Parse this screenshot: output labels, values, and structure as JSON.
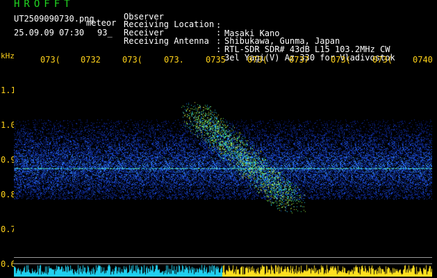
{
  "header": {
    "app": "HROFFT",
    "filename": "UT2509090730.png",
    "type": "meteor",
    "datetime": "25.09.09 07:30",
    "count": "93_"
  },
  "metadata": [
    {
      "label": "Observer",
      "value": "Masaki Kano"
    },
    {
      "label": "Receiving Location",
      "value": "Shibukawa, Gunma, Japan"
    },
    {
      "label": "Receiver",
      "value": "RTL-SDR SDR# 43dB L15 103.2MHz CW"
    },
    {
      "label": "Receiving Antenna",
      "value": "3el Yagi(V) Az 330 for Vladivostok"
    }
  ],
  "separator": ":",
  "axis": {
    "unit": "kHz",
    "time_ticks": [
      "073(",
      "0732",
      "073(",
      "073.",
      "0735",
      "073(",
      "0737",
      "073(",
      "073(",
      "0740"
    ],
    "freq_ticks": [
      "1.1",
      "1.0",
      "0.9",
      "0.8",
      "0.7",
      "0.6"
    ]
  },
  "colors": {
    "title": "#22d622",
    "axis": "#ffd21a",
    "text": "#ffffff",
    "background": "#000000"
  }
}
